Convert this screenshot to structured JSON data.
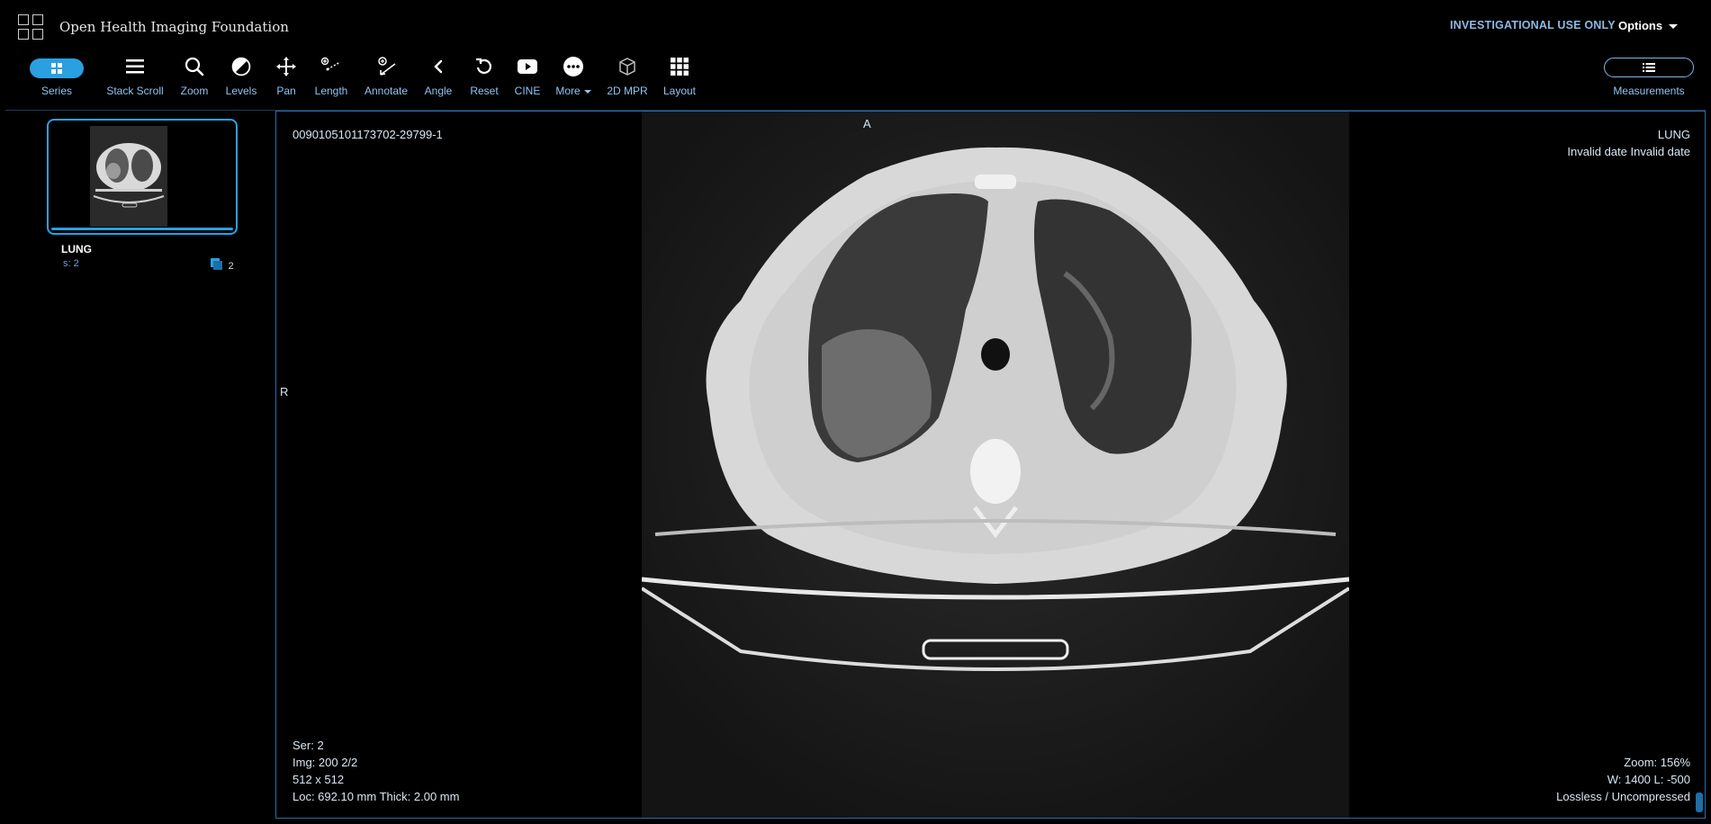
{
  "app": {
    "title": "Open Health Imaging Foundation",
    "notice": "INVESTIGATIONAL USE ONLY",
    "options_label": "Options"
  },
  "toolbar": {
    "series": "Series",
    "stack_scroll": "Stack Scroll",
    "zoom": "Zoom",
    "levels": "Levels",
    "pan": "Pan",
    "length": "Length",
    "annotate": "Annotate",
    "angle": "Angle",
    "reset": "Reset",
    "cine": "CINE",
    "more": "More",
    "mpr": "2D MPR",
    "layout": "Layout",
    "measurements": "Measurements"
  },
  "series_panel": {
    "name": "LUNG",
    "series_label": "s: 2",
    "image_count": "2"
  },
  "viewport": {
    "top_left": "0090105101173702-29799-1",
    "orient_top": "A",
    "orient_left": "R",
    "top_right_1": "LUNG",
    "top_right_2": "Invalid date Invalid date",
    "bottom_left": [
      "Ser: 2",
      "Img: 200 2/2",
      "512 x 512",
      "Loc: 692.10 mm Thick: 2.00 mm"
    ],
    "bottom_right": [
      "Zoom: 156%",
      "W: 1400 L: -500",
      "Lossless / Uncompressed"
    ]
  },
  "colors": {
    "accent": "#2aa0e0",
    "label": "#8fc3f1",
    "notice": "#8fb8e6",
    "border": "#2b6ca3"
  }
}
